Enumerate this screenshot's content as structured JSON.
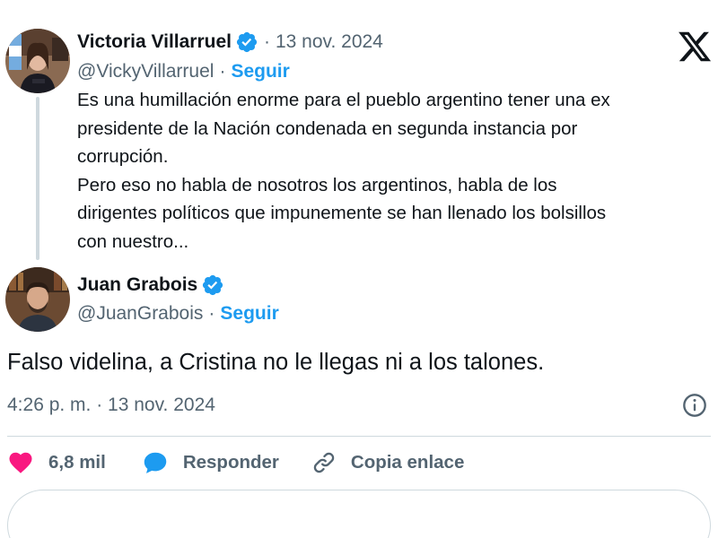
{
  "quoted_post": {
    "author_name": "Victoria Villarruel",
    "meta_sep": "·",
    "date": "13 nov. 2024",
    "handle": "@VickyVillarruel",
    "handle_sep": "·",
    "follow_label": "Seguir",
    "text_lines": [
      "Es una humillación enorme para el pueblo argentino tener una ex",
      "presidente de la Nación condenada en segunda instancia por",
      "corrupción.",
      "Pero eso no habla de nosotros los argentinos, habla de los",
      "dirigentes políticos que impunemente se han llenado los bolsillos",
      "con nuestro..."
    ]
  },
  "main_post": {
    "author_name": "Juan Grabois",
    "handle": "@JuanGrabois",
    "handle_sep": "·",
    "follow_label": "Seguir",
    "text": "Falso videlina, a Cristina no le llegas ni a los talones.",
    "timestamp": "4:26 p. m. · 13 nov. 2024"
  },
  "actions": {
    "likes": "6,8 mil",
    "reply_label": "Responder",
    "copy_link_label": "Copia enlace"
  },
  "icons": {
    "verified": "verified-badge-icon",
    "x_logo": "x-logo-icon",
    "info": "info-icon",
    "heart": "heart-icon",
    "reply": "reply-bubble-icon",
    "link": "link-icon"
  },
  "colors": {
    "accent": "#1d9bf0",
    "heart": "#f91880",
    "text": "#0f1419",
    "muted": "#536471",
    "border": "#cfd9de"
  }
}
